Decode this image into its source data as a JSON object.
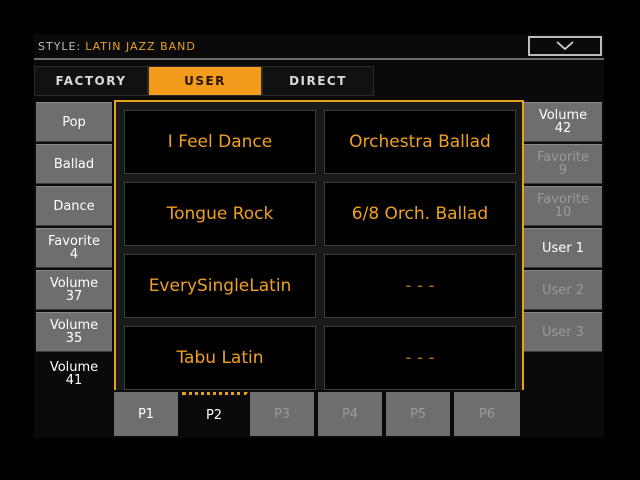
{
  "header": {
    "style_prefix": "STYLE:",
    "style_value": "LATIN JAZZ BAND",
    "dropdown_icon": "chevron-down-icon"
  },
  "tabs": [
    {
      "label": "FACTORY",
      "active": false
    },
    {
      "label": "USER",
      "active": true
    },
    {
      "label": "DIRECT",
      "active": false
    }
  ],
  "left_buttons": [
    {
      "label": "Pop",
      "active": false
    },
    {
      "label": "Ballad",
      "active": false
    },
    {
      "label": "Dance",
      "active": false
    },
    {
      "label": "Favorite\n4",
      "active": false
    },
    {
      "label": "Volume\n37",
      "active": false
    },
    {
      "label": "Volume\n35",
      "active": false
    },
    {
      "label": "Volume\n41",
      "active": true
    }
  ],
  "styles": [
    "I Feel Dance",
    "Orchestra Ballad",
    "Tongue Rock",
    "6/8 Orch. Ballad",
    "EverySingleLatin",
    "- - -",
    "Tabu Latin",
    "- - -"
  ],
  "right_buttons": [
    {
      "label": "Volume\n42",
      "dim": false
    },
    {
      "label": "Favorite\n9",
      "dim": true
    },
    {
      "label": "Favorite\n10",
      "dim": true
    },
    {
      "label": "User 1",
      "dim": false
    },
    {
      "label": "User 2",
      "dim": true
    },
    {
      "label": "User 3",
      "dim": true
    }
  ],
  "pages": [
    {
      "label": "P1",
      "active": false,
      "dim": false
    },
    {
      "label": "P2",
      "active": true,
      "dim": false
    },
    {
      "label": "P3",
      "active": false,
      "dim": true
    },
    {
      "label": "P4",
      "active": false,
      "dim": true
    },
    {
      "label": "P5",
      "active": false,
      "dim": true
    },
    {
      "label": "P6",
      "active": false,
      "dim": true
    }
  ],
  "colors": {
    "accent": "#f29b1c",
    "style_text": "#f0a020",
    "button_gray": "#6e6e6e"
  }
}
